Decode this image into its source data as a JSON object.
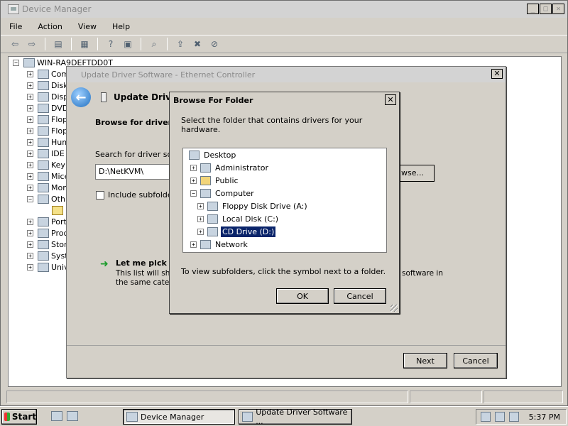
{
  "device_manager": {
    "title": "Device Manager",
    "window_buttons": [
      "_",
      "□",
      "✕"
    ],
    "menu": [
      "File",
      "Action",
      "View",
      "Help"
    ],
    "toolbar": [
      "back-icon",
      "forward-icon",
      "console-tree-icon",
      "properties-icon",
      "help-icon",
      "view-icon",
      "scan-hardware-icon",
      "update-driver-icon",
      "uninstall-icon",
      "disable-icon"
    ],
    "tree": {
      "root": "WIN-RA9DEFTDD0T",
      "items": [
        "Com",
        "Disk",
        "Disp",
        "DVD",
        "Flop",
        "Flop",
        "Hum",
        "IDE",
        "Key",
        "Mice",
        "Mon",
        "Oth",
        "",
        "Port",
        "Proc",
        "Stor",
        "Syst",
        "Univ"
      ],
      "expanders": [
        "+",
        "+",
        "+",
        "+",
        "+",
        "+",
        "+",
        "+",
        "+",
        "+",
        "+",
        "−",
        "",
        "+",
        "+",
        "+",
        "+",
        "+"
      ]
    }
  },
  "update_driver": {
    "title": "Update Driver Software - Ethernet Controller",
    "header": "Update Driver Software - Ethernet Controller",
    "heading": "Browse for driver s",
    "search_label": "Search for driver sof",
    "path": "D:\\NetKVM\\",
    "browse_label": "wse...",
    "include_subfolders": "Include subfolde",
    "pick_title": "Let me pick fr",
    "pick_desc_line1": "This list will show",
    "pick_desc_line2": "the same categ",
    "pick_desc_right": "software in",
    "next_label": "Next",
    "cancel_label": "Cancel"
  },
  "browse_folder": {
    "title": "Browse For Folder",
    "close": "✕",
    "instructions": "Select the folder that contains drivers for your hardware.",
    "tree": [
      {
        "label": "Desktop",
        "expander": "",
        "icon": "desktop-icon",
        "selected": false
      },
      {
        "label": "Administrator",
        "expander": "+",
        "icon": "user-folder-icon",
        "selected": false
      },
      {
        "label": "Public",
        "expander": "+",
        "icon": "folder-icon",
        "selected": false
      },
      {
        "label": "Computer",
        "expander": "−",
        "icon": "computer-icon",
        "selected": false
      },
      {
        "label": "Floppy Disk Drive (A:)",
        "expander": "+",
        "icon": "floppy-drive-icon",
        "selected": false
      },
      {
        "label": "Local Disk (C:)",
        "expander": "+",
        "icon": "local-disk-icon",
        "selected": false
      },
      {
        "label": "CD Drive (D:)",
        "expander": "+",
        "icon": "cd-drive-icon",
        "selected": true
      },
      {
        "label": "Network",
        "expander": "+",
        "icon": "network-icon",
        "selected": false
      }
    ],
    "subfolder_hint": "To view subfolders, click the symbol next to a folder.",
    "ok_label": "OK",
    "cancel_label": "Cancel"
  },
  "taskbar": {
    "start_label": "Start",
    "tasks": [
      "Device Manager",
      "Update Driver Software ..."
    ],
    "clock": "5:37 PM"
  }
}
